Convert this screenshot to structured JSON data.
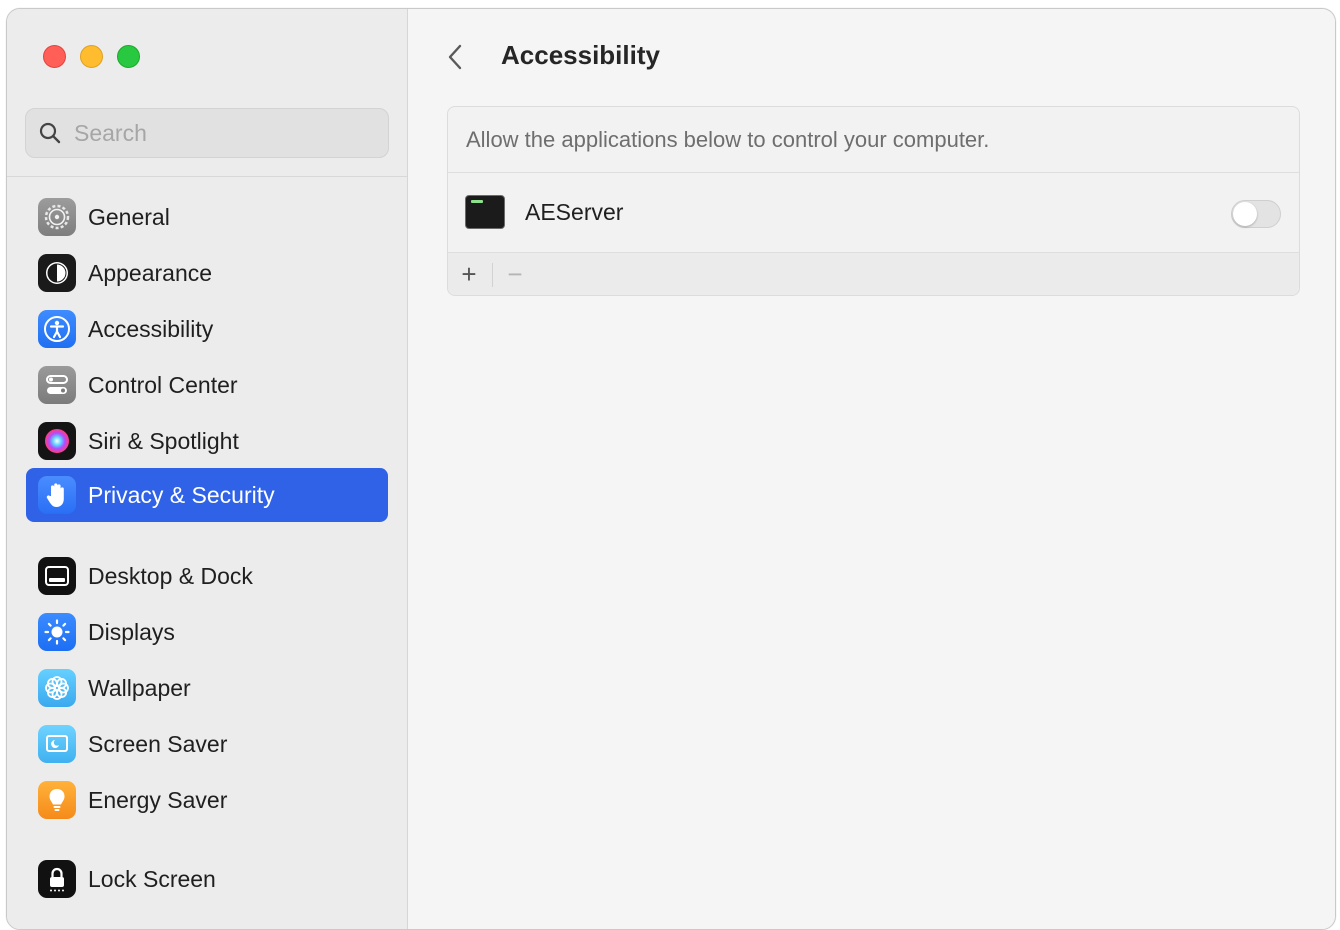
{
  "window": {
    "title": "Accessibility"
  },
  "search": {
    "placeholder": "Search"
  },
  "sidebar": {
    "items": [
      {
        "label": "General",
        "icon": "gear-icon"
      },
      {
        "label": "Appearance",
        "icon": "appearance-icon"
      },
      {
        "label": "Accessibility",
        "icon": "accessibility-icon"
      },
      {
        "label": "Control Center",
        "icon": "control-center-icon"
      },
      {
        "label": "Siri & Spotlight",
        "icon": "siri-icon"
      },
      {
        "label": "Privacy & Security",
        "icon": "hand-icon",
        "selected": true
      },
      {
        "label": "Desktop & Dock",
        "icon": "dock-icon"
      },
      {
        "label": "Displays",
        "icon": "sun-icon"
      },
      {
        "label": "Wallpaper",
        "icon": "flower-icon"
      },
      {
        "label": "Screen Saver",
        "icon": "screen-saver-icon"
      },
      {
        "label": "Energy Saver",
        "icon": "lightbulb-icon"
      },
      {
        "label": "Lock Screen",
        "icon": "lock-icon"
      }
    ]
  },
  "main": {
    "title": "Accessibility",
    "panel": {
      "description": "Allow the applications below to control your computer.",
      "apps": [
        {
          "name": "AEServer",
          "icon": "terminal-icon",
          "enabled": false
        }
      ],
      "add_label": "+",
      "remove_label": "−"
    }
  },
  "colors": {
    "accent": "#2f62e6",
    "close": "#ff5f57",
    "minimize": "#febc2e",
    "zoom": "#28c840"
  }
}
